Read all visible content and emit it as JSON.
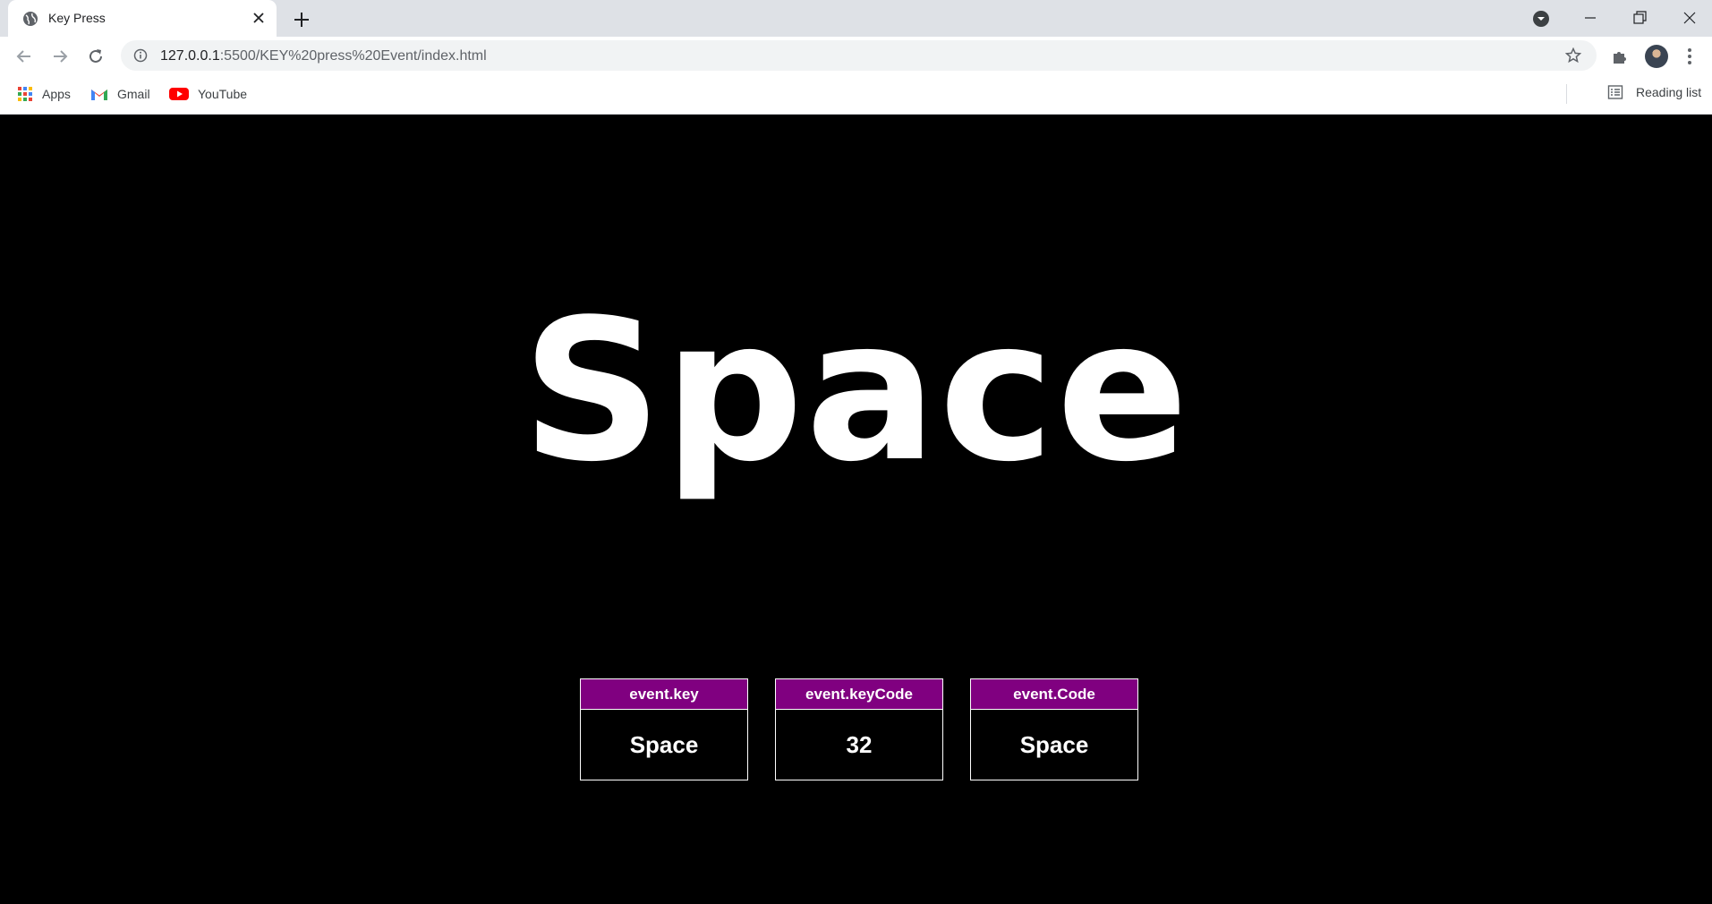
{
  "browser": {
    "tab_title": "Key Press",
    "url_host": "127.0.0.1",
    "url_rest": ":5500/KEY%20press%20Event/index.html",
    "bookmarks": [
      "Apps",
      "Gmail",
      "YouTube"
    ],
    "reading_list_label": "Reading list"
  },
  "page": {
    "big_key": "Space",
    "background_color": "#000000",
    "accent_color": "#800080",
    "cards": [
      {
        "label": "event.key",
        "value": "Space"
      },
      {
        "label": "event.keyCode",
        "value": "32"
      },
      {
        "label": "event.Code",
        "value": "Space"
      }
    ]
  }
}
